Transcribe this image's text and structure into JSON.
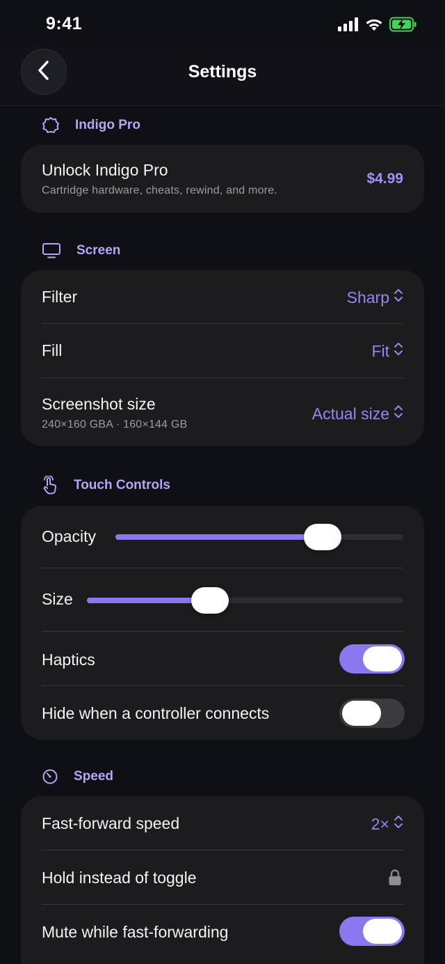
{
  "status_bar": {
    "time": "9:41"
  },
  "nav": {
    "title": "Settings"
  },
  "colors": {
    "accent": "#8b78ef",
    "background": "#0f0f16",
    "card": "#1c1c1f"
  },
  "sections": {
    "pro": {
      "header": "Indigo Pro",
      "icon": "seal-badge-icon",
      "unlock_title": "Unlock Indigo Pro",
      "unlock_subtitle": "Cartridge hardware, cheats, rewind, and more.",
      "price": "$4.99"
    },
    "screen": {
      "header": "Screen",
      "icon": "monitor-icon",
      "filter_label": "Filter",
      "filter_value": "Sharp",
      "fill_label": "Fill",
      "fill_value": "Fit",
      "screenshot_label": "Screenshot size",
      "screenshot_sub": "240×160 GBA · 160×144 GB",
      "screenshot_value": "Actual size"
    },
    "touch": {
      "header": "Touch Controls",
      "icon": "hand-pointer-icon",
      "opacity_label": "Opacity",
      "opacity_level": 0.72,
      "size_label": "Size",
      "size_level": 0.39,
      "haptics_label": "Haptics",
      "haptics_on": true,
      "hide_label": "Hide when a controller connects",
      "hide_on": false
    },
    "speed": {
      "header": "Speed",
      "icon": "speedometer-icon",
      "ff_label": "Fast-forward speed",
      "ff_value": "2×",
      "hold_label": "Hold instead of toggle",
      "hold_icon": "lock-icon",
      "mute_label": "Mute while fast-forwarding",
      "mute_on": true
    }
  }
}
